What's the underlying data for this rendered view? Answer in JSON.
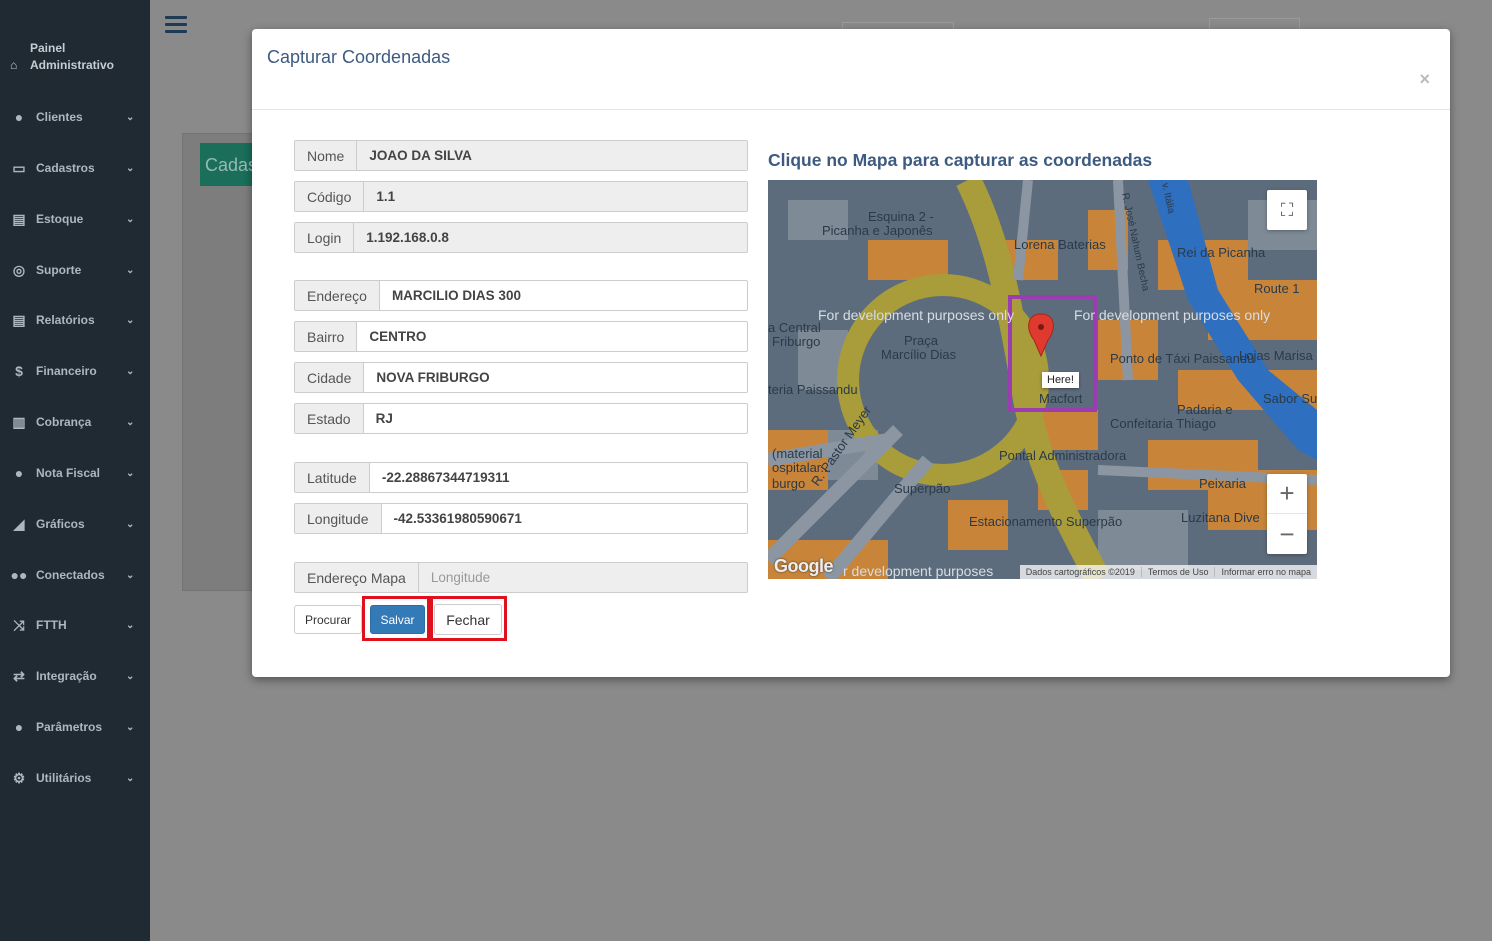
{
  "sidebar": {
    "brand": "Painel Administrativo",
    "items": [
      {
        "label": "Clientes",
        "icon": "user-icon"
      },
      {
        "label": "Cadastros",
        "icon": "folder-icon"
      },
      {
        "label": "Estoque",
        "icon": "print-icon"
      },
      {
        "label": "Suporte",
        "icon": "lifebuoy-icon"
      },
      {
        "label": "Relatórios",
        "icon": "print-icon"
      },
      {
        "label": "Financeiro",
        "icon": "dollar-icon"
      },
      {
        "label": "Cobrança",
        "icon": "barcode-icon"
      },
      {
        "label": "Nota Fiscal",
        "icon": "user-icon"
      },
      {
        "label": "Gráficos",
        "icon": "area-chart-icon"
      },
      {
        "label": "Conectados",
        "icon": "users-icon"
      },
      {
        "label": "FTTH",
        "icon": "random-icon"
      },
      {
        "label": "Integração",
        "icon": "exchange-icon"
      },
      {
        "label": "Parâmetros",
        "icon": "user-icon"
      },
      {
        "label": "Utilitários",
        "icon": "cogs-icon"
      }
    ]
  },
  "background": {
    "green_label": "Cadas"
  },
  "modal": {
    "title": "Capturar Coordenadas",
    "close": "×",
    "fields": {
      "nome": {
        "label": "Nome",
        "value": "JOAO DA SILVA"
      },
      "codigo": {
        "label": "Código",
        "value": "1.1"
      },
      "login": {
        "label": "Login",
        "value": "1.192.168.0.8"
      },
      "endereco": {
        "label": "Endereço",
        "value": "MARCILIO DIAS 300"
      },
      "bairro": {
        "label": "Bairro",
        "value": "CENTRO"
      },
      "cidade": {
        "label": "Cidade",
        "value": "NOVA FRIBURGO"
      },
      "estado": {
        "label": "Estado",
        "value": "RJ"
      },
      "latitude": {
        "label": "Latitude",
        "value": "-22.28867344719311"
      },
      "longitude": {
        "label": "Longitude",
        "value": "-42.53361980590671"
      },
      "endereco_mapa": {
        "label": "Endereço Mapa",
        "placeholder": "Longitude"
      }
    },
    "buttons": {
      "procurar": "Procurar",
      "salvar": "Salvar",
      "fechar": "Fechar"
    },
    "map": {
      "heading": "Clique no Mapa para capturar as coordenadas",
      "marker_label": "Here!",
      "dev_notice": "For development purposes only",
      "dev_notice_partial": "For development purposes only",
      "dev_notice_bottom": "r development purposes",
      "logo": "Google",
      "footer": [
        "Dados cartográficos ©2019",
        "Termos de Uso",
        "Informar erro no mapa"
      ],
      "zoom_in": "+",
      "zoom_out": "−",
      "places": {
        "esquina": "Esquina 2 -",
        "picanha": "Picanha e Japonês",
        "lorena": "Lorena Baterias",
        "rei": "Rei da Picanha",
        "route": "Route 1",
        "pr": "Pr",
        "central": "a Central",
        "friburgo": "Friburgo",
        "praca": "Praça",
        "marcilio": "Marcílio Dias",
        "ponto": "Ponto de Táxi Paissandú",
        "lojas": "Lojas Marisa",
        "macfort": "Macfort",
        "padaria": "Padaria e",
        "confeitaria": "Confeitaria Thiago",
        "sabor": "Sabor Su",
        "teria": "teria Paissandu",
        "material": "(material",
        "hospitalar": "ospitalar...",
        "burgo": "burgo",
        "pontal": "Pontal Administradora",
        "superpao": "Superpão",
        "pastor": "R. Pastor Meyer",
        "estacionamento": "Estacionamento Superpão",
        "peixaria": "Peixaria",
        "luzitana": "Luzitana Dive",
        "jose": "R. José Nahum Becha",
        "italia": "v. Itália"
      }
    }
  }
}
